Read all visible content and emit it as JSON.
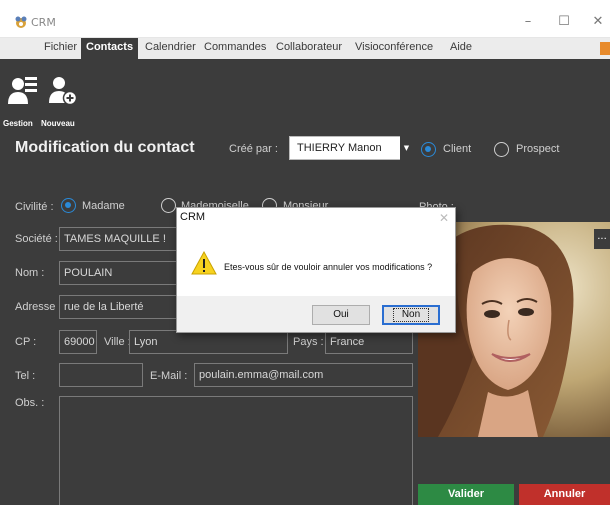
{
  "window": {
    "title": "CRM",
    "minimize": "–",
    "maximize": "☐",
    "close": "✕"
  },
  "menu": [
    "Fichier",
    "Contacts",
    "Calendrier",
    "Commandes",
    "Collaborateur",
    "Visioconférence",
    "Aide"
  ],
  "ribbon": {
    "gestion": "Gestion",
    "nouveau": "Nouveau"
  },
  "form": {
    "title": "Modification du contact",
    "cree_par_label": "Créé par :",
    "cree_par_value": "THIERRY Manon",
    "type_client": "Client",
    "type_prospect": "Prospect",
    "civilite_label": "Civilité :",
    "civ_madame": "Madame",
    "civ_mademoiselle": "Mademoiselle",
    "civ_monsieur": "Monsieur",
    "photo_label": "Photo :",
    "societe_label": "Société :",
    "societe_value": "TAMES MAQUILLE !",
    "nom_label": "Nom :",
    "nom_value": "POULAIN",
    "adresse_label": "Adresse :",
    "adresse_value": "rue de la Liberté",
    "cp_label": "CP :",
    "cp_value": "69000",
    "ville_label": "Ville :",
    "ville_value": "Lyon",
    "pays_label": "Pays :",
    "pays_value": "France",
    "tel_label": "Tel :",
    "tel_value": "",
    "email_label": "E-Mail :",
    "email_value": "poulain.emma@mail.com",
    "obs_label": "Obs. :",
    "more": "...",
    "valider": "Valider",
    "annuler": "Annuler"
  },
  "dialog": {
    "title": "CRM",
    "close": "✕",
    "message": "Etes-vous sûr de vouloir annuler vos modifications ?",
    "oui": "Oui",
    "non": "Non"
  },
  "colors": {
    "accent": "#2a8ad8",
    "valider": "#2d8a44",
    "annuler": "#c0302b",
    "background": "#3c3c3c"
  }
}
